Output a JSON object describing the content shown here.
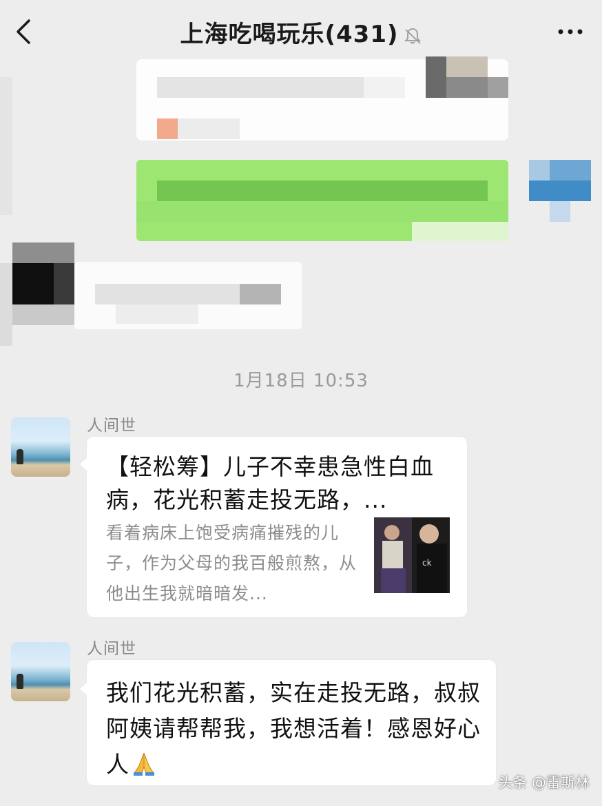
{
  "header": {
    "title": "上海吃喝玩乐(431)",
    "back_icon": "chevron-left-icon",
    "mute_icon": "bell-muted-icon",
    "more_icon": "more-dots-icon"
  },
  "timestamp": "1月18日 10:53",
  "messages": [
    {
      "sender": "人间世",
      "card_title": "【轻松筹】儿子不幸患急性白血病，花光积蓄走投无路，...",
      "card_desc": "看着病床上饱受病痛摧残的儿子，作为父母的我百般煎熬，从他出生我就暗暗发..."
    },
    {
      "sender": "人间世",
      "text": "我们花光积蓄，实在走投无路，叔叔阿姨请帮帮我，我想活着！感恩好心人",
      "emoji": "pray-icon"
    }
  ],
  "watermark": "头条 @雷斯林",
  "colors": {
    "background": "#ededed",
    "bubble_self": "#95ec69",
    "bubble_other": "#ffffff",
    "timestamp": "#9a9a9a",
    "sender": "#888888"
  }
}
